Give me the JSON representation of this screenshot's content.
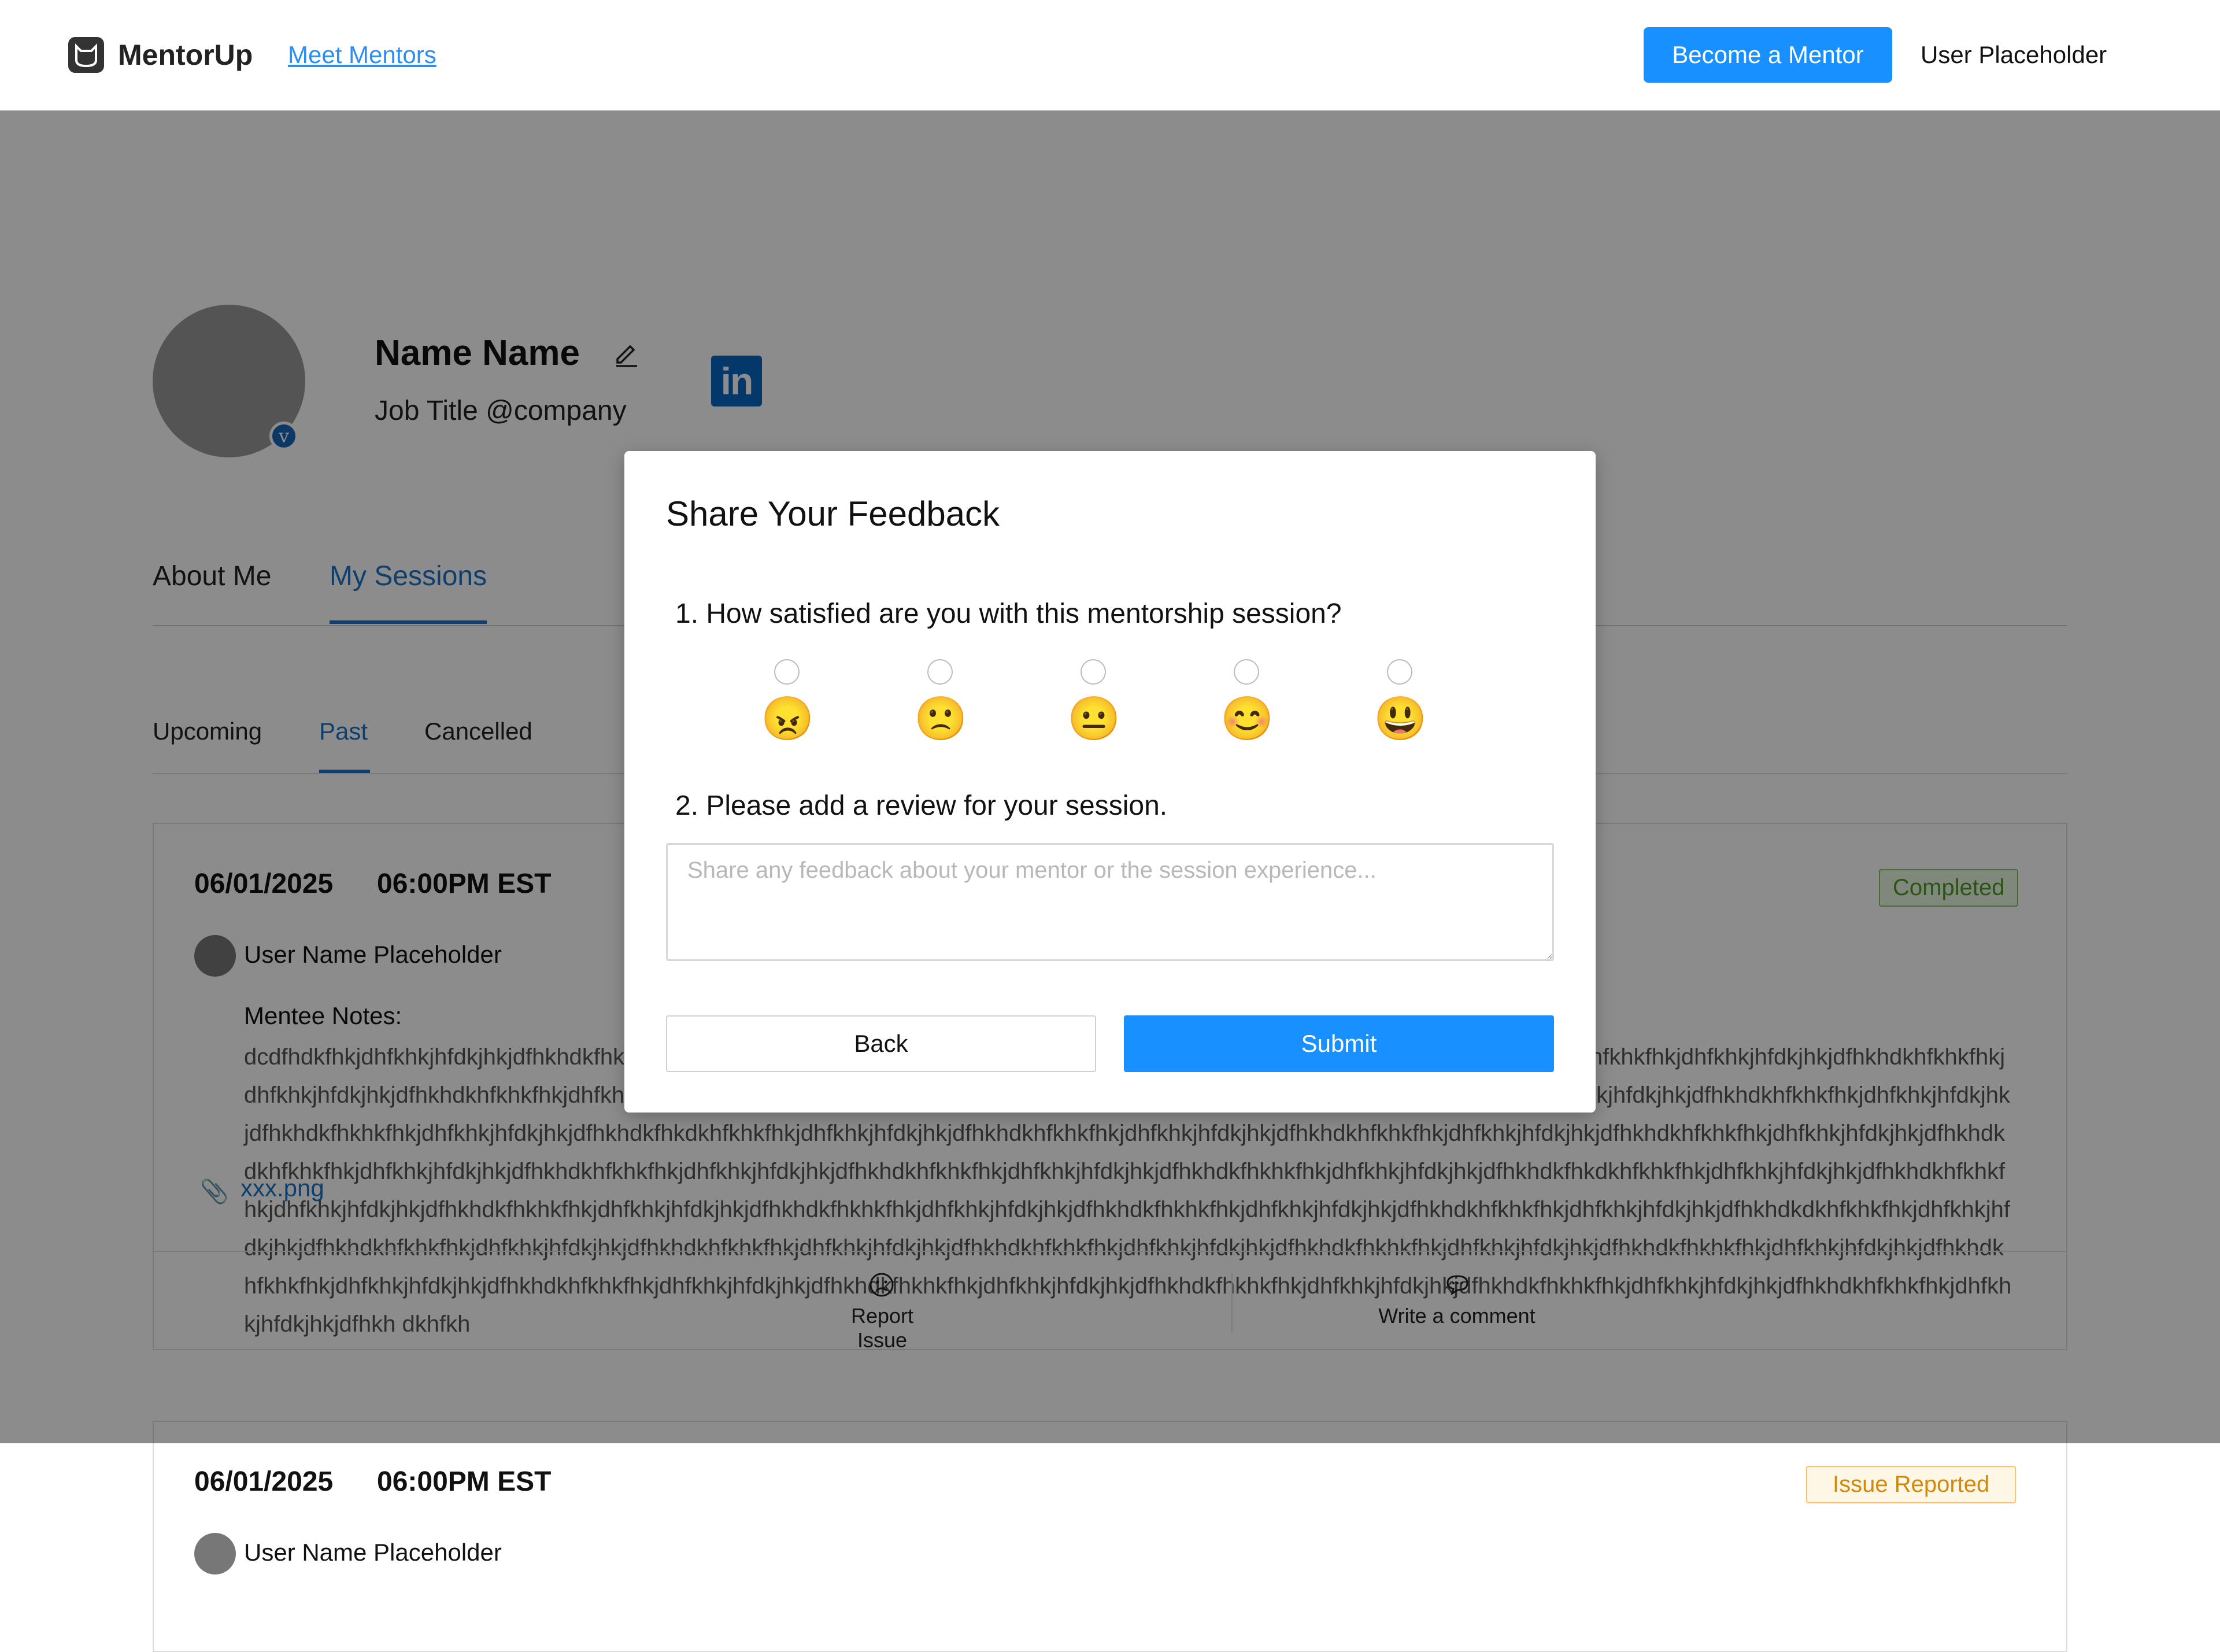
{
  "header": {
    "logo_text": "MentorUp",
    "nav_link": "Meet Mentors",
    "become_mentor": "Become a Mentor",
    "user": "User Placeholder"
  },
  "profile": {
    "name": "Name Name",
    "job_title": "Job Title @company",
    "verified_glyph": "v",
    "linkedin_glyph": "in"
  },
  "tabs": [
    "About Me",
    "My Sessions"
  ],
  "subtabs": [
    "Upcoming",
    "Past",
    "Cancelled"
  ],
  "sessions": [
    {
      "date": "06/01/2025",
      "time": "06:00PM EST",
      "user": "User Name Placeholder",
      "status": "Completed",
      "notes_label": "Mentee Notes:",
      "notes": "dcdfhdkfhkjdhfkhkjhfdkjhkjdfhkhdkfhkhkfhkjdhfkhkjhfdkjhkjdfhkhdkhfkhkfhkjdhfkhkjhfdkjhkjdfhkhdkfhkhkfhkjdhfkhkjhfdkjhkjdfhkhdkdkhfkhkfhkjdhfkhkjhfdkjhkjdfhkhdkhfkhkfhkjdhfkhkjhfdkjhkjdfhkhdkhfkhkfhkjdhfkhkjhfdkjhkjdfhkhdkhfkhkfhkjdhfkhkjhfdkjhkjdfhkhdkfhkhkfhkjdhfkhkjhfdkjhkjdfhkhdkhfkhkfhkjdhfkhkjhfdkjhkjdfhkhdkhfkhkfhkjdhfkhkjhfdkjhkjdfhkhdkfhkhkfhkjdhfkhkjhfdkjhkjdfhkhdkfhkdkhfkhkfhkjdhfkhkjhfdkjhkjdfhkhdkhfkhkfhkjdhfkhkjhfdkjhkjdfhkhdkhfkhkfhkjdhfkhkjhfdkjhkjdfhkhdkhfkhkfhkjdhfkhkjhfdkjhkjdfhkhdkdkhfkhkfhkjdhfkhkjhfdkjhkjdfhkhdkhfkhkfhkjdhfkhkjhfdkjhkjdfhkhdkhfkhkfhkjdhfkhkjhfdkjhkjdfhkhdkfhkhkfhkjdhfkhkjhfdkjhkjdfhkhdkfhkdkhfkhkfhkjdhfkhkjhfdkjhkjdfhkhdkhfkhkfhkjdhfkhkjhfdkjhkjdfhkhdkfhkhkfhkjdhfkhkjhfdkjhkjdfhkhdkfhkhkfhkjdhfkhkjhfdkjhkjdfhkhdkfhkhkfhkjdhfkhkjhfdkjhkjdfhkhdkhfkhkfhkjdhfkhkjhfdkjhkjdfhkhdkdkhfkhkfhkjdhfkhkjhfdkjhkjdfhkhdkhfkhkfhkjdhfkhkjhfdkjhkjdfhkhdkhfkhkfhkjdhfkhkjhfdkjhkjdfhkhdkhfkhkfhkjdhfkhkjhfdkjhkjdfhkhdkfhkhkfhkjdhfkhkjhfdkjhkjdfhkhdkfhkhkfhkjdhfkhkjhfdkjhkjdfhkhdkhfkhkfhkjdhfkhkjhfdkjhkjdfhkhdkhfkhkfhkjdhfkhkjhfdkjhkjdfhkhdkfhkhkfhkjdhfkhkjhfdkjhkjdfhkhdkfhkhkfhkjdhfkhkjhfdkjhkjdfhkhdkfhkhkfhkjdhfkhkjhfdkjhkjdfhkhdkhfkhkfhkjdhfkhkjhfdkjhkjdfhkh dkhfkh",
      "attachment": "xxx.png",
      "actions": [
        "Report Issue",
        "Write a comment"
      ]
    },
    {
      "date": "06/01/2025",
      "time": "06:00PM EST",
      "user": "User Name Placeholder",
      "status": "Issue Reported"
    }
  ],
  "modal": {
    "title": "Share Your Feedback",
    "question1": "1.  How satisfied are you with this mentorship session?",
    "rating_options": [
      {
        "emoji": "😠",
        "icon": "angry-face-icon"
      },
      {
        "emoji": "🙁",
        "icon": "frowning-face-icon"
      },
      {
        "emoji": "😐",
        "icon": "neutral-face-icon"
      },
      {
        "emoji": "😊",
        "icon": "smiling-face-icon"
      },
      {
        "emoji": "😃",
        "icon": "grinning-face-icon"
      }
    ],
    "question2": "2.  Please add a review for your session.",
    "review_placeholder": "Share any feedback about your mentor or the session experience...",
    "review_value": "",
    "back": "Back",
    "submit": "Submit"
  },
  "colors": {
    "accent": "#1890ff",
    "link": "#1a73c8",
    "completed": "#4f9a2a",
    "issue_reported": "#d48806",
    "overlay": "rgba(0,0,0,0.45)"
  }
}
